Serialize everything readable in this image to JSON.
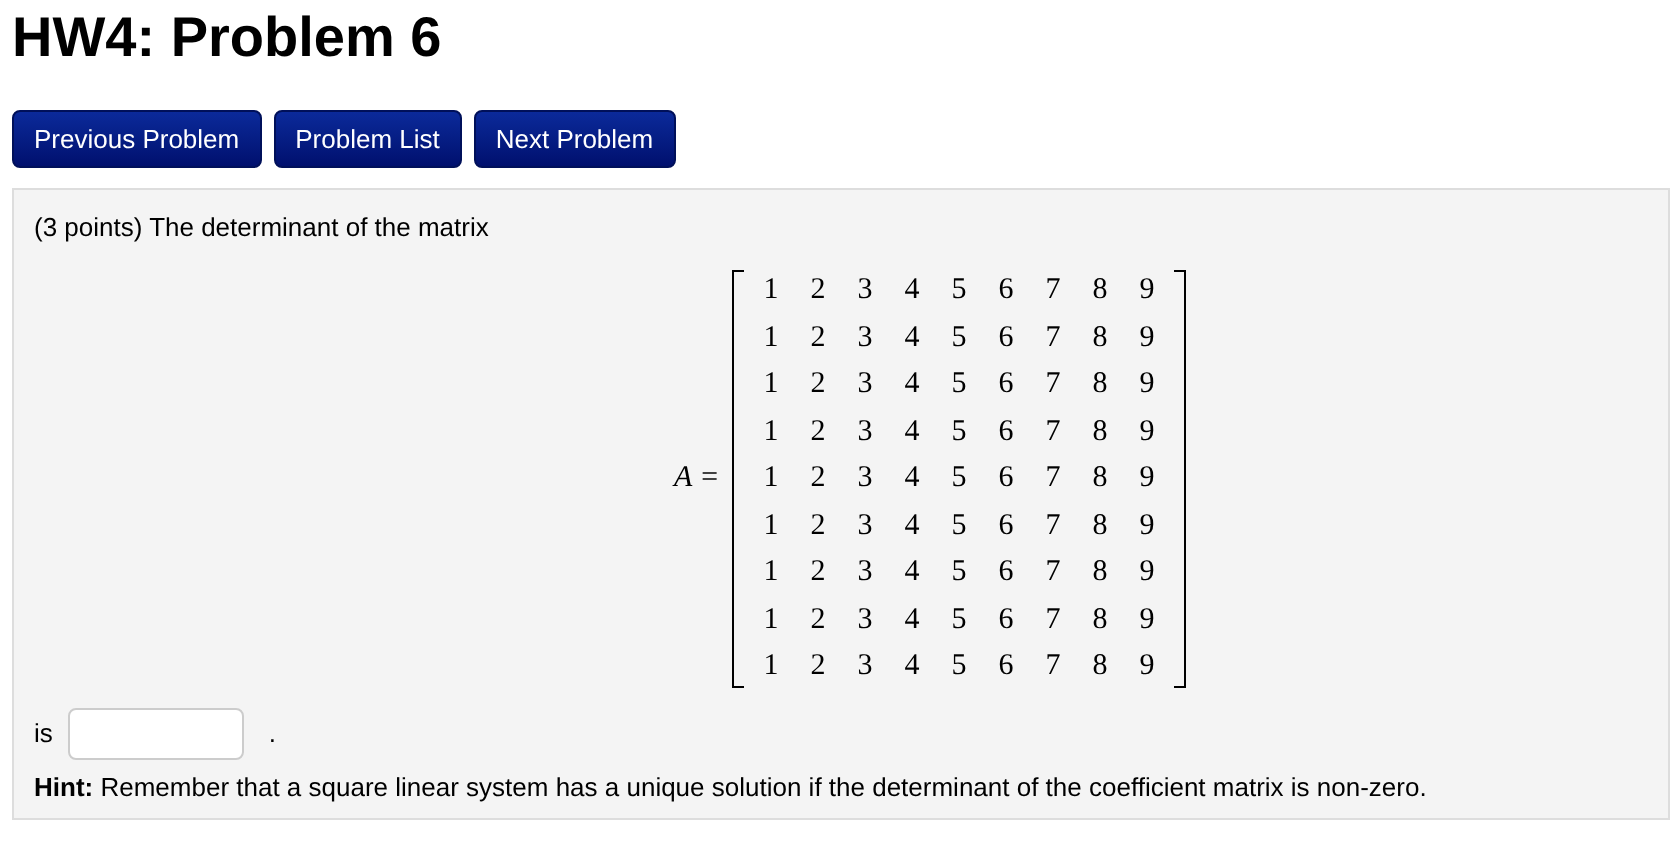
{
  "title": "HW4: Problem 6",
  "buttons": [
    "Previous Problem",
    "Problem List",
    "Next Problem"
  ],
  "problem": {
    "intro": "(3 points) The determinant of the matrix",
    "matrix_label": "A =",
    "matrix": [
      [
        "1",
        "2",
        "3",
        "4",
        "5",
        "6",
        "7",
        "8",
        "9"
      ],
      [
        "1",
        "2",
        "3",
        "4",
        "5",
        "6",
        "7",
        "8",
        "9"
      ],
      [
        "1",
        "2",
        "3",
        "4",
        "5",
        "6",
        "7",
        "8",
        "9"
      ],
      [
        "1",
        "2",
        "3",
        "4",
        "5",
        "6",
        "7",
        "8",
        "9"
      ],
      [
        "1",
        "2",
        "3",
        "4",
        "5",
        "6",
        "7",
        "8",
        "9"
      ],
      [
        "1",
        "2",
        "3",
        "4",
        "5",
        "6",
        "7",
        "8",
        "9"
      ],
      [
        "1",
        "2",
        "3",
        "4",
        "5",
        "6",
        "7",
        "8",
        "9"
      ],
      [
        "1",
        "2",
        "3",
        "4",
        "5",
        "6",
        "7",
        "8",
        "9"
      ],
      [
        "1",
        "2",
        "3",
        "4",
        "5",
        "6",
        "7",
        "8",
        "9"
      ]
    ],
    "answer_prefix": "is",
    "answer_suffix": ".",
    "hint": "**Hint:** Remember that a square linear system has a unique solution if the determinant of the coefficient matrix is non-zero."
  }
}
